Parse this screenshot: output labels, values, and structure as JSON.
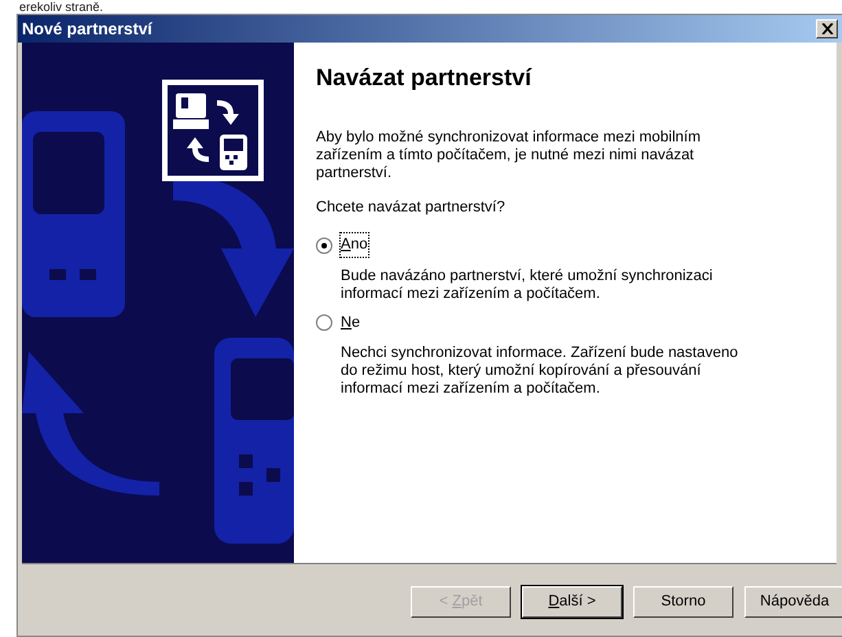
{
  "page_text": "erekoliv straně.",
  "window": {
    "title": "Nové partnerství"
  },
  "heading": "Navázat partnerství",
  "intro": "Aby bylo možné synchronizovat informace mezi mobilním zařízením a tímto počítačem, je nutné mezi nimi navázat partnerství.",
  "question": "Chcete navázat partnerství?",
  "options": [
    {
      "label": "Ano",
      "mnemonic": true,
      "selected": true,
      "focused": true,
      "description": "Bude navázáno partnerství, které umožní synchronizaci informací mezi zařízením a počítačem."
    },
    {
      "label": "Ne",
      "mnemonic": true,
      "selected": false,
      "focused": false,
      "description": "Nechci synchronizovat informace. Zařízení bude nastaveno do režimu host, který umožní kopírování a přesouvání informací mezi zařízením a počítačem."
    }
  ],
  "buttons": [
    {
      "label": "< Zpět",
      "mnemonic": true,
      "disabled": true,
      "default": false
    },
    {
      "label": "Další >",
      "mnemonic": true,
      "disabled": false,
      "default": true
    },
    {
      "label": "Storno",
      "mnemonic": false,
      "disabled": false,
      "default": false
    },
    {
      "label": "Nápověda",
      "mnemonic": false,
      "disabled": false,
      "default": false
    }
  ]
}
